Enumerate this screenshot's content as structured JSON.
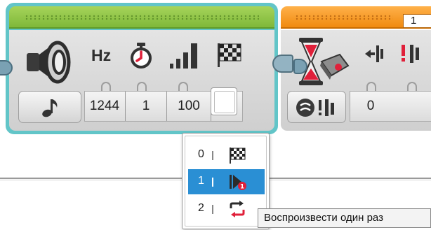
{
  "sound_block": {
    "icons": [
      "speaker-icon",
      "stopwatch-icon",
      "volume-bars-icon",
      "checkered-flag-icon"
    ],
    "labels": {
      "frequency_unit": "Hz"
    },
    "mode_icon": "music-note-icon",
    "values": {
      "frequency": "1244",
      "duration": "1",
      "volume": "100"
    }
  },
  "wait_block": {
    "header_number": "1",
    "icons": [
      "hourglass-icon",
      "sensor-port-icon",
      "compare-left-icon",
      "compare-alert-icon"
    ],
    "mode_icon": "sensor-compare-icon",
    "values": {
      "first": "0"
    }
  },
  "playback_dropdown": {
    "items": [
      {
        "number": "0",
        "icon": "checkered-flag-icon"
      },
      {
        "number": "1",
        "icon": "play-once-icon"
      },
      {
        "number": "2",
        "icon": "repeat-icon"
      }
    ],
    "selected_index": 1,
    "tooltip": "Воспроизвести один раз"
  },
  "colors": {
    "sound_header": "#8bc34a",
    "block_outline": "#62c5c8",
    "wait_header": "#f7941d",
    "selected_item": "#2a8fd4"
  }
}
